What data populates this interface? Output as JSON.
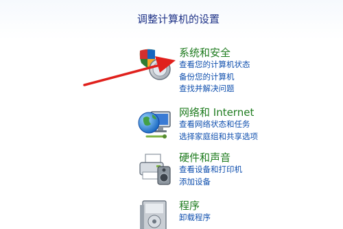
{
  "page": {
    "title": "调整计算机的设置"
  },
  "categories": [
    {
      "icon": "security-shield-icon",
      "title": "系统和安全",
      "links": [
        "查看您的计算机状态",
        "备份您的计算机",
        "查找并解决问题"
      ]
    },
    {
      "icon": "network-globe-icon",
      "title": "网络和 Internet",
      "links": [
        "查看网络状态和任务",
        "选择家庭组和共享选项"
      ]
    },
    {
      "icon": "printer-speaker-icon",
      "title": "硬件和声音",
      "links": [
        "查看设备和打印机",
        "添加设备"
      ]
    },
    {
      "icon": "programs-box-icon",
      "title": "程序",
      "links": [
        "卸载程序"
      ]
    }
  ],
  "colors": {
    "page_title": "#1e3287",
    "category_title": "#1e7b1e",
    "link": "#0f4fae",
    "annotation_arrow": "#e0201c"
  }
}
